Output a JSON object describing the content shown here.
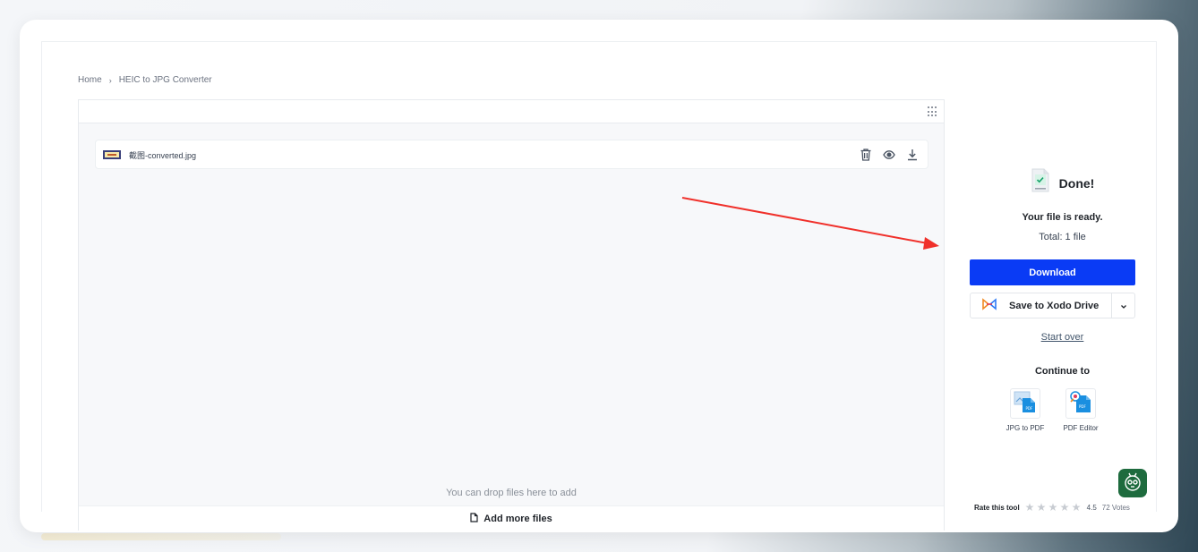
{
  "breadcrumb": {
    "home": "Home",
    "separator": "›",
    "current": "HEIC to JPG Converter"
  },
  "file": {
    "name": "截图-converted.jpg",
    "actions": [
      "trash-icon",
      "eye-icon",
      "download-icon"
    ]
  },
  "dropzone": {
    "hint": "You can drop files here to add",
    "add_more_label": "Add more files"
  },
  "result": {
    "title": "Done!",
    "ready_text": "Your file is ready.",
    "total_text": "Total: 1 file",
    "download_label": "Download",
    "save_label": "Save to Xodo Drive",
    "start_over_label": "Start over",
    "continue_label": "Continue to",
    "tools": [
      {
        "label": "JPG to PDF",
        "icon": "jpg-to-pdf-icon"
      },
      {
        "label": "PDF Editor",
        "icon": "pdf-editor-icon"
      }
    ]
  },
  "rating": {
    "label": "Rate this tool",
    "score": "4.5",
    "votes": "72 Votes",
    "max_stars": 5
  },
  "colors": {
    "primary": "#0a3bf5",
    "annotation_arrow": "#f0302a",
    "bot_bg": "#1e6b3e"
  }
}
